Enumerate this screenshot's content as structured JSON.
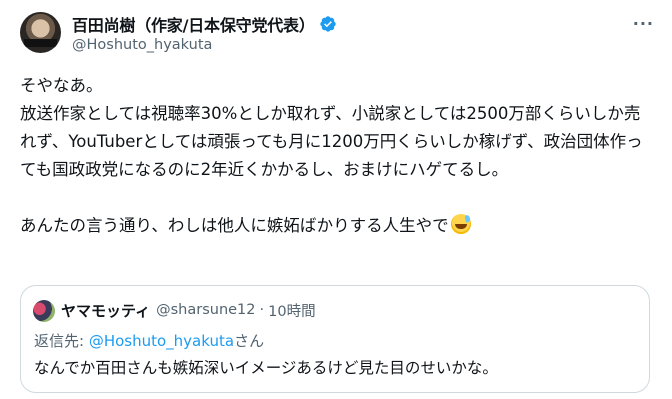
{
  "author": {
    "display_name": "百田尚樹（作家/日本保守党代表）",
    "handle": "@Hoshuto_hyakuta"
  },
  "tweet": {
    "text": "そやなあ。\n放送作家としては視聴率30%としか取れず、小説家としては2500万部くらいしか売れず、YouTuberとしては頑張っても月に1200万円くらいしか稼げず、政治団体作っても国政政党になるのに2年近くかかるし、おまけにハゲてるし。\n\nあんたの言う通り、わしは他人に嫉妬ばかりする人生やで"
  },
  "quote": {
    "display_name": "ヤマモッティ",
    "handle": "@sharsune12",
    "separator": "·",
    "time": "10時間",
    "reply_prefix": "返信先: ",
    "reply_mention": "@Hoshuto_hyakuta",
    "reply_suffix": "さん",
    "text": "なんでか百田さんも嫉妬深いイメージあるけど見た目のせいかな。"
  },
  "icons": {
    "verified": "verified-badge-icon",
    "more": "more-options-icon",
    "emoji": "grinning-sweat-emoji"
  },
  "colors": {
    "accent": "#1d9bf0",
    "text_primary": "#0f1419",
    "text_secondary": "#536471",
    "border": "#cfd9de"
  }
}
